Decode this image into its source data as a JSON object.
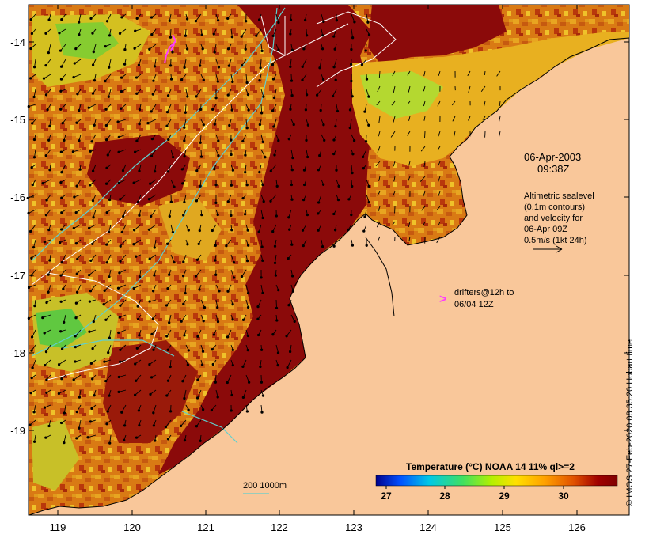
{
  "map": {
    "title_date": "06-Apr-2003",
    "title_time": "09:38Z",
    "x_ticks": [
      "119",
      "120",
      "121",
      "122",
      "123",
      "124",
      "125",
      "126"
    ],
    "y_ticks": [
      "-14",
      "-15",
      "-16",
      "-17",
      "-18",
      "-19"
    ],
    "altimetry_note": [
      "Altimetric sealevel",
      "(0.1m contours)",
      "and velocity for",
      "06-Apr 09Z",
      "0.5m/s (1kt 24h)"
    ],
    "drifter_symbol": ">",
    "drifter_note": [
      "drifters@12h to",
      "06/04 12Z"
    ],
    "isobath_label": "200  1000m",
    "credit": "© IMOS 27-Feb-2020 08:35:20 Hobart time",
    "colors": {
      "land": "#f9c79a",
      "hot": "#8b0a0a",
      "warm_orange": "#d26a0e",
      "warm_yellow": "#e8b020",
      "green": "#7ac824",
      "contour": "#5fd0cf",
      "drifter": "#ff3cff"
    }
  },
  "colorbar": {
    "title": "Temperature (°C) NOAA 14 11% ql>=2",
    "ticks": [
      "27",
      "28",
      "29",
      "30"
    ],
    "stops": [
      "#00008c",
      "#0050ff",
      "#00c8e6",
      "#40e060",
      "#b4f000",
      "#ffe000",
      "#ffa000",
      "#e05000",
      "#a00000",
      "#800000"
    ]
  }
}
